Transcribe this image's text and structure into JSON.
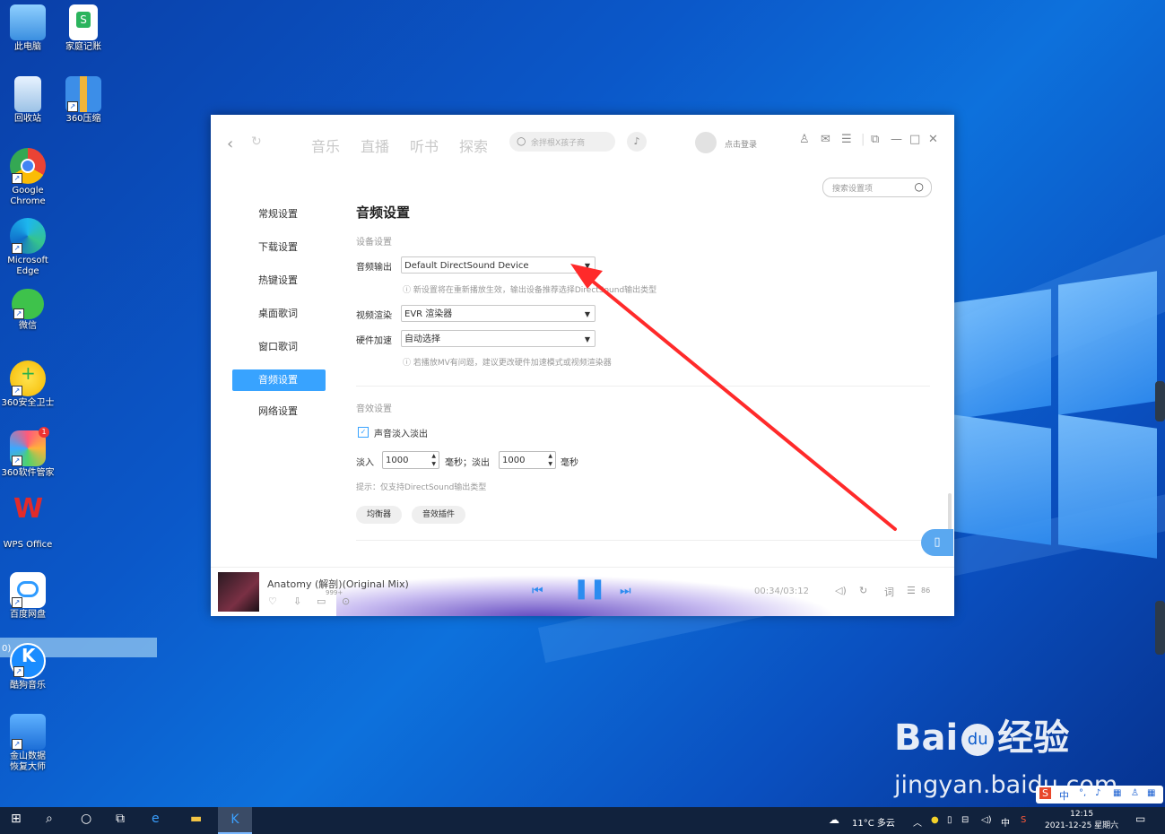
{
  "desktop": {
    "icons": [
      {
        "label": "此电脑",
        "name": "this-pc-icon"
      },
      {
        "label": "家庭记账",
        "name": "spreadsheet-file-icon"
      },
      {
        "label": "回收站",
        "name": "recycle-bin-icon"
      },
      {
        "label": "360压缩",
        "name": "zip-archive-icon"
      },
      {
        "label": "Google Chrome",
        "name": "chrome-icon"
      },
      {
        "label": "Microsoft Edge",
        "name": "edge-icon"
      },
      {
        "label": "微信",
        "name": "wechat-icon"
      },
      {
        "label": "360安全卫士",
        "name": "360-security-icon"
      },
      {
        "label": "360软件管家",
        "name": "360-software-manager-icon"
      },
      {
        "label": "WPS Office",
        "name": "wps-icon"
      },
      {
        "label": "百度网盘",
        "name": "baidu-netdisk-icon"
      },
      {
        "label": "酷狗音乐",
        "name": "kugou-music-icon"
      },
      {
        "label": "金山数据恢复大师",
        "name": "kingsoft-data-recovery-icon"
      }
    ],
    "selected_fragment": "0)",
    "badge_360": "1"
  },
  "app": {
    "nav_tabs": [
      "音乐",
      "直播",
      "听书",
      "探索"
    ],
    "search_placeholder": "余拌根X孩子商",
    "login_text": "点击登录",
    "settings_search_placeholder": "搜索设置项",
    "side_items": [
      "常规设置",
      "下载设置",
      "热键设置",
      "桌面歌词",
      "窗口歌词",
      "音频设置",
      "网络设置"
    ],
    "active_side_item": "音频设置",
    "page_title": "音频设置",
    "device_section": "设备设置",
    "audio_output_label": "音频输出",
    "audio_output_value": "Default DirectSound Device",
    "audio_output_hint": "新设置将在重新播放生效，输出设备推荐选择DirectSound输出类型",
    "video_render_label": "视频渲染",
    "video_render_value": "EVR 渲染器",
    "hw_accel_label": "硬件加速",
    "hw_accel_value": "自动选择",
    "hw_accel_hint": "若播放MV有问题，建议更改硬件加速模式或视频渲染器",
    "effect_section": "音效设置",
    "fade_checkbox_label": "声音淡入淡出",
    "fade_in_label": "淡入",
    "fade_in_value": "1000",
    "ms_label_1": "毫秒；淡出",
    "fade_out_value": "1000",
    "ms_label_2": "毫秒",
    "tip": "提示：仅支持DirectSound输出类型",
    "equalizer_button": "均衡器",
    "plugin_button": "音效插件"
  },
  "player": {
    "song_title": "Anatomy (解剖)(Original Mix)",
    "comment_count": "999+",
    "time": "00:34/03:12",
    "lyrics_label": "词",
    "playlist_count": "86"
  },
  "watermark": {
    "brand": "Bai",
    "brand_du": "du",
    "brand_cn": "经验",
    "url": "jingyan.baidu.com"
  },
  "taskbar": {
    "weather": "11°C 多云",
    "ime": "中",
    "time": "12:15",
    "date": "2021-12-25 星期六"
  }
}
